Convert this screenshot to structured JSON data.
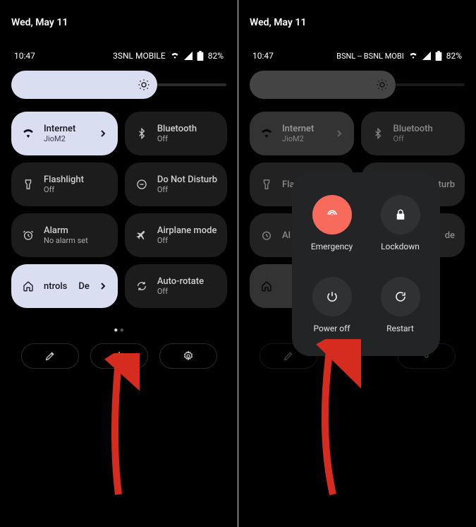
{
  "left": {
    "date": "Wed, May 11",
    "time": "10:47",
    "carrier": "3SNL MOBILE",
    "battery": "82%",
    "brightness": {
      "fillColor": "#d9def1",
      "trackColor": "#2a2a2a"
    },
    "tiles": {
      "internet": {
        "title": "Internet",
        "sub": "JioM2"
      },
      "bluetooth": {
        "title": "Bluetooth",
        "sub": "Off"
      },
      "flashlight": {
        "title": "Flashlight",
        "sub": "Off"
      },
      "dnd": {
        "title": "Do Not Disturb",
        "sub": "Off"
      },
      "alarm": {
        "title": "Alarm",
        "sub": "No alarm set"
      },
      "airplane": {
        "title": "Airplane mode",
        "sub": "Off"
      },
      "controls": {
        "left": "ntrols",
        "right": "De"
      },
      "autorotate": {
        "title": "Auto-rotate",
        "sub": "Off"
      }
    }
  },
  "right": {
    "date": "Wed, May 11",
    "time": "10:47",
    "carrier": "BSNL -- BSNL MOBI",
    "battery": "82%",
    "brightness": {
      "fillColor": "#444444",
      "trackColor": "#1a1a1a"
    },
    "tiles": {
      "internet": {
        "title": "Internet",
        "sub": "JioM2"
      },
      "bluetooth": {
        "title": "Bluetooth",
        "sub": "Off"
      },
      "flashlight": {
        "title": "Flas"
      },
      "dnd": {
        "title": "sturb"
      },
      "alarm": {
        "title": "Al"
      },
      "airplane": {
        "title": "de"
      }
    },
    "powermenu": {
      "emergency": "Emergency",
      "lockdown": "Lockdown",
      "poweroff": "Power off",
      "restart": "Restart"
    }
  },
  "colors": {
    "accentRed": "#f76b5d",
    "arrow": "#d62b1f"
  }
}
